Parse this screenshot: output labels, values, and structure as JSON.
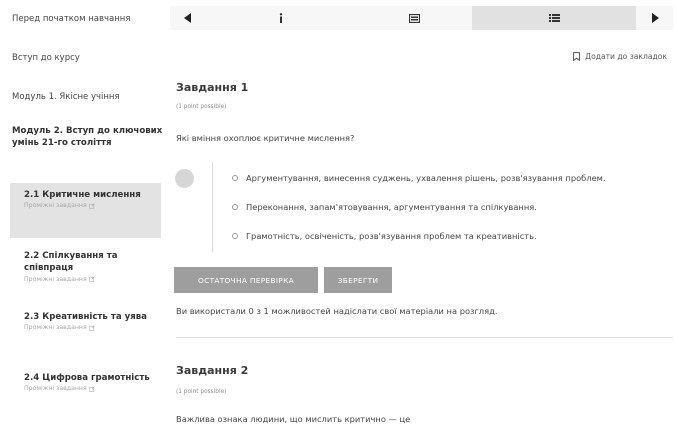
{
  "sidebar": {
    "top_items": [
      "Перед початком навчання",
      "Вступ до курсу",
      "Модуль 1. Якісне учіння"
    ],
    "current_unit": "Модуль 2. Вступ до ключових умінь 21-го століття",
    "subsections": [
      {
        "title": "2.1 Критичне мислення",
        "sub": "Проміжні завдання"
      },
      {
        "title": "2.2 Спілкування та співпраця",
        "sub": "Проміжні завдання"
      },
      {
        "title": "2.3 Креативність та уява",
        "sub": "Проміжні завдання"
      },
      {
        "title": "2.4 Цифрова грамотність",
        "sub": "Проміжні завдання"
      }
    ]
  },
  "sequence_nav": {
    "units": [
      "info-icon",
      "video-icon",
      "problem-list-icon"
    ],
    "active_index": 2
  },
  "bookmark": {
    "label": "Додати до закладок"
  },
  "problems": [
    {
      "title": "Завдання 1",
      "points": "(1 point possible)",
      "question": "Які вміння охоплює критичне мислення?",
      "options": [
        "Аргументування, винесення суджень, ухвалення рішень, розв'язування проблем.",
        "Переконання, запам'ятовування, аргументування та спілкування.",
        "Грамотність, освіченість, розв'язування проблем та креативність."
      ],
      "submit_label": "ОСТАТОЧНА ПЕРЕВІРКА",
      "save_label": "ЗБЕРЕГТИ",
      "attempts": "Ви використали 0 з 1 можливостей надіслати свої матеріали на розгляд."
    },
    {
      "title": "Завдання 2",
      "points": "(1 point possible)",
      "question": "Важлива ознака людини, що мислить критично — це"
    }
  ],
  "colors": {
    "button": "#9e9e9e",
    "active_bg": "#e3e3e3",
    "nav_bg": "#f7f7f7"
  }
}
